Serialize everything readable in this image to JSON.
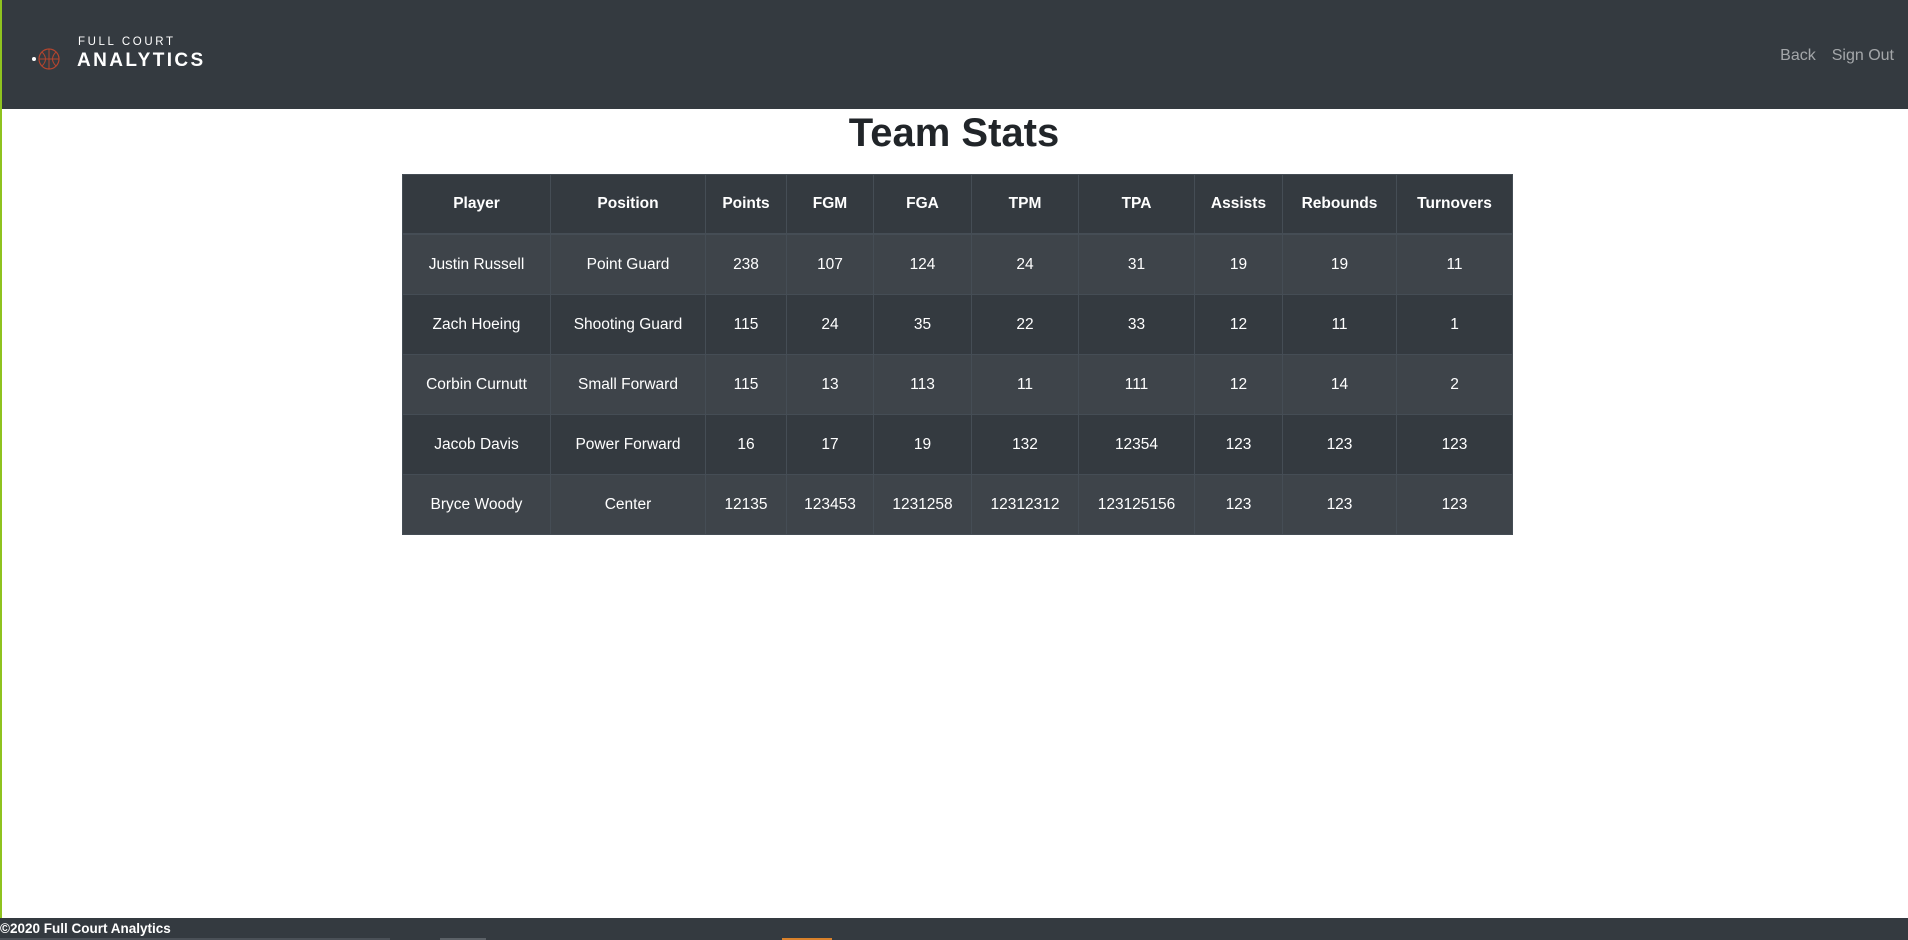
{
  "brand": {
    "line1": "FULL COURT",
    "line2": "ANALYTICS"
  },
  "nav": {
    "back_label": "Back",
    "signout_label": "Sign Out"
  },
  "page": {
    "title": "Team Stats"
  },
  "table": {
    "columns": [
      "Player",
      "Position",
      "Points",
      "FGM",
      "FGA",
      "TPM",
      "TPA",
      "Assists",
      "Rebounds",
      "Turnovers"
    ],
    "rows": [
      [
        "Justin Russell",
        "Point Guard",
        "238",
        "107",
        "124",
        "24",
        "31",
        "19",
        "19",
        "11"
      ],
      [
        "Zach Hoeing",
        "Shooting Guard",
        "115",
        "24",
        "35",
        "22",
        "33",
        "12",
        "11",
        "1"
      ],
      [
        "Corbin Curnutt",
        "Small Forward",
        "115",
        "13",
        "113",
        "11",
        "111",
        "12",
        "14",
        "2"
      ],
      [
        "Jacob Davis",
        "Power Forward",
        "16",
        "17",
        "19",
        "132",
        "12354",
        "123",
        "123",
        "123"
      ],
      [
        "Bryce Woody",
        "Center",
        "12135",
        "123453",
        "1231258",
        "12312312",
        "123125156",
        "123",
        "123",
        "123"
      ]
    ]
  },
  "footer": {
    "text": "©2020 Full Court Analytics"
  },
  "colors": {
    "navbar": "#343a40",
    "accent_left": "#8fc31f",
    "basketball": "#b5452e"
  }
}
